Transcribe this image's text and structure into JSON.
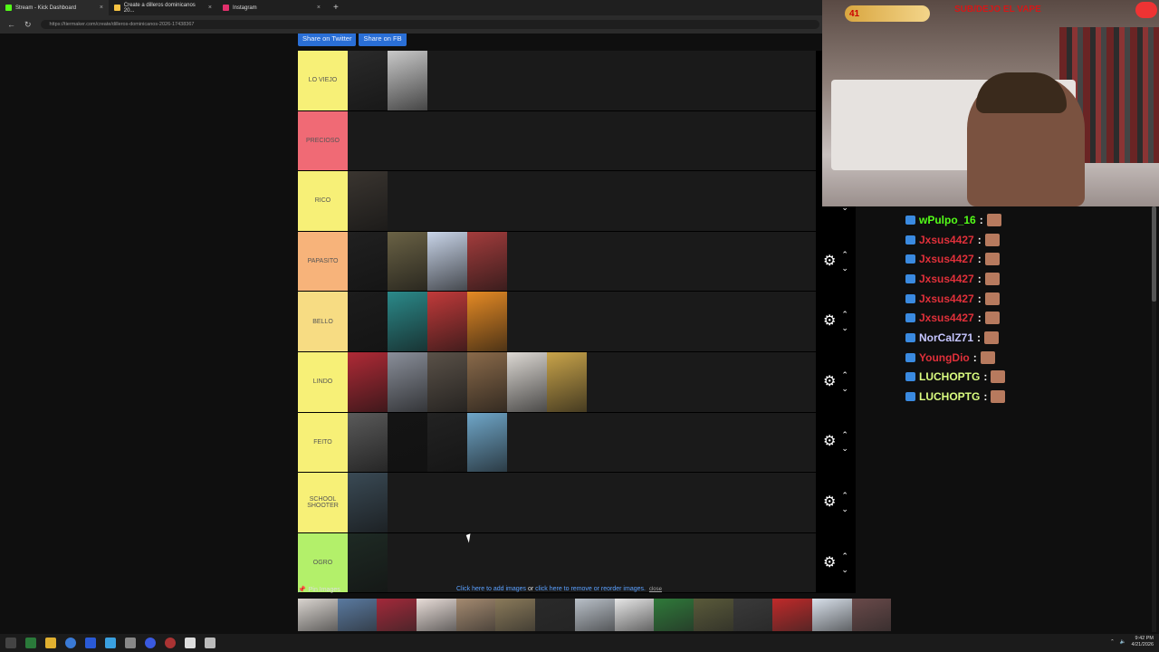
{
  "browser": {
    "tabs": [
      {
        "label": "Stream - Kick Dashboard",
        "color": "#53fc18"
      },
      {
        "label": "Create a dilleros dominicanos 20...",
        "color": "#f5c242"
      },
      {
        "label": "Instagram",
        "color": "#e1306c"
      }
    ],
    "new_tab": "+",
    "url": "https://tiermaker.com/create/dilleros-dominicanos-2026-17438367"
  },
  "share": {
    "twitter": "Share on Twitter",
    "fb": "Share on FB"
  },
  "tiers": [
    {
      "label": "LO VIEJO",
      "color": "#f7f077",
      "thumbs": [
        "#2a2a2a",
        "#c9c9c9"
      ]
    },
    {
      "label": "PRECIOSO",
      "color": "#f06a75",
      "thumbs": []
    },
    {
      "label": "RICO",
      "color": "#f7f077",
      "thumbs": [
        "#3a3530"
      ]
    },
    {
      "label": "PAPASITO",
      "color": "#f7b37a",
      "thumbs": [
        "#202020",
        "#6a6245",
        "#c8d4e8",
        "#a33c3c"
      ]
    },
    {
      "label": "BELLO",
      "color": "#f7dc83",
      "thumbs": [
        "#1c1c1c",
        "#2b8a8a",
        "#c13a3a",
        "#e58a24"
      ]
    },
    {
      "label": "LINDO",
      "color": "#f7f077",
      "thumbs": [
        "#b02a36",
        "#8a8f9a",
        "#5a5148",
        "#8a6a4a",
        "#dcd8d3",
        "#c9a44a"
      ]
    },
    {
      "label": "FEITO",
      "color": "#f7f077",
      "thumbs": [
        "#5a5a5a",
        "#141414",
        "#222",
        "#6fa6c8"
      ]
    },
    {
      "label": "SCHOOL SHOOTER",
      "color": "#f7f077",
      "thumbs": [
        "#3a4a55"
      ]
    },
    {
      "label": "OGRO",
      "color": "#b3f06a",
      "thumbs": [
        "#1e2a24"
      ]
    }
  ],
  "bottom": {
    "pin_label": "Pin Images",
    "add_link": "Click here to add images",
    "or_text": " or ",
    "remove_link": "click here to remove or reorder images.",
    "close_link": "close"
  },
  "pool": [
    "#d9d4cf",
    "#5a7aa0",
    "#a3293a",
    "#e8ddd8",
    "#a48a70",
    "#8a7a5a",
    "#2a2a2a",
    "#b9c0c8",
    "#e6e6e6",
    "#2f7a3a",
    "#5a5a3a",
    "#3a3a3a",
    "#c02a2a",
    "#d8e0ea",
    "#6a4a4a"
  ],
  "stream": {
    "counter": "41",
    "title": "SUB/DEJO EL VAPE"
  },
  "chat": [
    {
      "user": "wPulpo_16",
      "color": "#53fc18"
    },
    {
      "user": "Jxsus4427",
      "color": "#e0303a"
    },
    {
      "user": "Jxsus4427",
      "color": "#e0303a"
    },
    {
      "user": "Jxsus4427",
      "color": "#e0303a"
    },
    {
      "user": "Jxsus4427",
      "color": "#e0303a"
    },
    {
      "user": "Jxsus4427",
      "color": "#e0303a"
    },
    {
      "user": "NorCalZ71",
      "color": "#c6c6ff"
    },
    {
      "user": "YoungDio",
      "color": "#e0303a"
    },
    {
      "user": "LUCHOPTG",
      "color": "#dafc80"
    },
    {
      "user": "LUCHOPTG",
      "color": "#dafc80"
    }
  ],
  "chat_sep": ":",
  "clock": {
    "time": "9:42 PM",
    "date": "4/21/2026"
  }
}
